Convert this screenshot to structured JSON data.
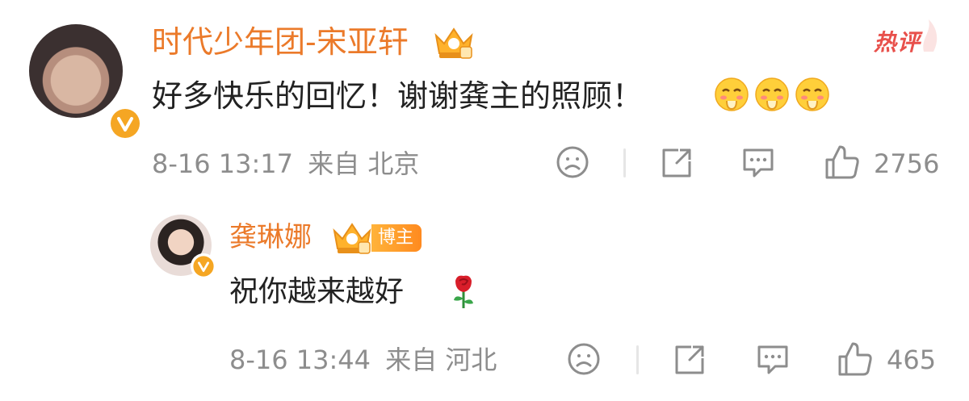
{
  "comment": {
    "username": "时代少年团-宋亚轩",
    "text": "好多快乐的回忆！谢谢龚主的照顾！",
    "emoji_icons": [
      "blush-emoji",
      "blush-emoji",
      "blush-emoji"
    ],
    "hot_label": "热评",
    "date": "8-16",
    "time": "13:17",
    "from_label": "来自",
    "location": "北京",
    "like_count": "2756"
  },
  "reply": {
    "username": "龚琳娜",
    "badge_label": "博主",
    "text": "祝你越来越好",
    "trailing_icon": "rose-icon",
    "date": "8-16",
    "time": "13:44",
    "from_label": "来自",
    "location": "河北",
    "like_count": "465"
  },
  "colors": {
    "username": "#eb7a2a",
    "hot": "#e8504b",
    "meta": "#8d8d8d",
    "verified": "#f5a623"
  }
}
